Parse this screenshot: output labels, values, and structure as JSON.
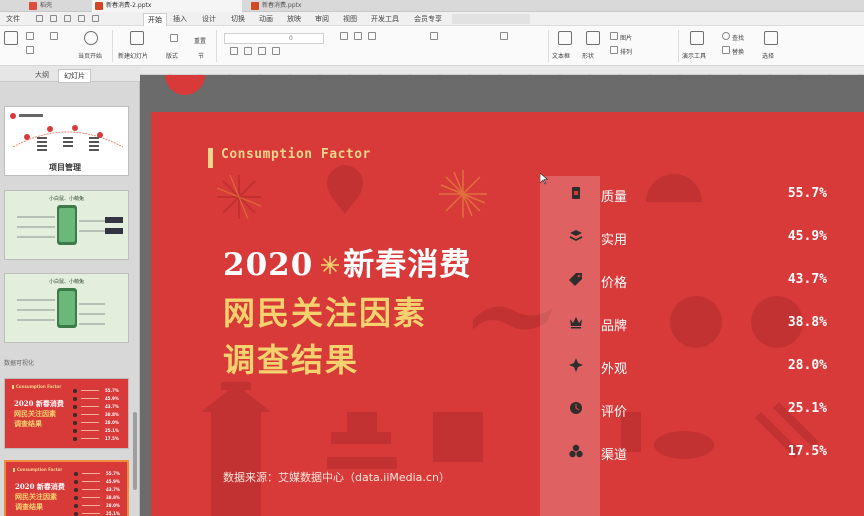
{
  "tabs": [
    {
      "label": "稻壳"
    },
    {
      "label": "新春消费-2.pptx"
    },
    {
      "label": "新春消费.pptx"
    }
  ],
  "menu": {
    "file": "文件",
    "items": [
      "开始",
      "插入",
      "设计",
      "切换",
      "动画",
      "放映",
      "审阅",
      "视图",
      "开发工具",
      "会员专享"
    ]
  },
  "ribbon": {
    "play_from_current": "当页开始",
    "new_slide": "新建幻灯片",
    "layout": "版式",
    "section": "节",
    "reset": "重置",
    "font_size": "0",
    "textbox": "文本框",
    "shape": "形状",
    "picture": "图片",
    "arrange": "排列",
    "presentation_tools": "演示工具",
    "find": "查找",
    "replace": "替换",
    "select": "选择"
  },
  "left_panel": {
    "tab_outline": "大纲",
    "tab_slides": "幻灯片",
    "section_label": "数据可视化",
    "thumb_project_title": "项目管理",
    "thumb_phone_title": "小白鼠、小萌兔"
  },
  "slide": {
    "consumption_factor": "Consumption Factor",
    "title_line1_year": "2020",
    "title_line1_text": "新春消费",
    "title_line2": "网民关注因素",
    "title_line3": "调查结果",
    "source": "数据来源：艾媒数据中心（data.iiMedia.cn）",
    "rows": [
      {
        "icon": "quality-icon",
        "label": "质量",
        "value": "55.7%"
      },
      {
        "icon": "practical-icon",
        "label": "实用",
        "value": "45.9%"
      },
      {
        "icon": "price-tag-icon",
        "label": "价格",
        "value": "43.7%"
      },
      {
        "icon": "crown-icon",
        "label": "品牌",
        "value": "38.8%"
      },
      {
        "icon": "appearance-icon",
        "label": "外观",
        "value": "28.0%"
      },
      {
        "icon": "review-icon",
        "label": "评价",
        "value": "25.1%"
      },
      {
        "icon": "channel-icon",
        "label": "渠道",
        "value": "17.5%"
      }
    ]
  },
  "thumb_rows": [
    "55.7%",
    "45.9%",
    "43.7%",
    "38.8%",
    "28.0%",
    "25.1%",
    "17.5%"
  ],
  "colors": {
    "slide_red": "#d83a3a",
    "gold": "#f4d36e",
    "selection_orange": "#f08a3c"
  }
}
